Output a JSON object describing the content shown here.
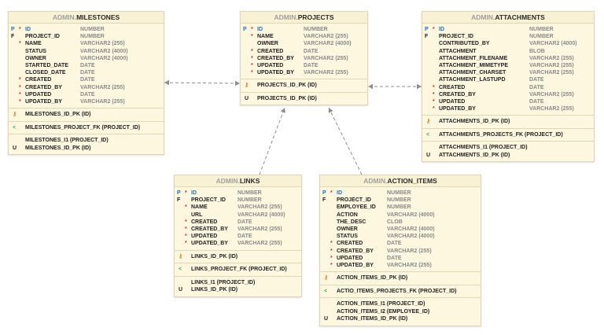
{
  "tables": [
    {
      "id": "milestones",
      "schema": "ADMIN.",
      "name": "MILESTONES",
      "columns": [
        {
          "key": "P",
          "req": "*",
          "name": "ID",
          "type": "NUMBER"
        },
        {
          "key": "F",
          "req": "",
          "name": "PROJECT_ID",
          "type": "NUMBER"
        },
        {
          "key": "",
          "req": "*",
          "name": "NAME",
          "type": "VARCHAR2 (255)"
        },
        {
          "key": "",
          "req": "",
          "name": "STATUS",
          "type": "VARCHAR2 (4000)"
        },
        {
          "key": "",
          "req": "",
          "name": "OWNER",
          "type": "VARCHAR2 (4000)"
        },
        {
          "key": "",
          "req": "",
          "name": "STARTED_DATE",
          "type": "DATE"
        },
        {
          "key": "",
          "req": "",
          "name": "CLOSED_DATE",
          "type": "DATE"
        },
        {
          "key": "",
          "req": "*",
          "name": "CREATED",
          "type": "DATE"
        },
        {
          "key": "",
          "req": "*",
          "name": "CREATED_BY",
          "type": "VARCHAR2 (255)"
        },
        {
          "key": "",
          "req": "*",
          "name": "UPDATED",
          "type": "DATE"
        },
        {
          "key": "",
          "req": "*",
          "name": "UPDATED_BY",
          "type": "VARCHAR2 (255)"
        }
      ],
      "pk": [
        "MILESTONES_ID_PK (ID)"
      ],
      "fk": [
        "MILESTONES_PROJECT_FK (PROJECT_ID)"
      ],
      "indexes": [
        {
          "u": "",
          "label": "MILESTONES_I1 (PROJECT_ID)"
        },
        {
          "u": "U",
          "label": "MILESTONES_ID_PK (ID)"
        }
      ]
    },
    {
      "id": "projects",
      "schema": "ADMIN.",
      "name": "PROJECTS",
      "columns": [
        {
          "key": "P",
          "req": "*",
          "name": "ID",
          "type": "NUMBER"
        },
        {
          "key": "",
          "req": "*",
          "name": "NAME",
          "type": "VARCHAR2 (255)"
        },
        {
          "key": "",
          "req": "",
          "name": "OWNER",
          "type": "VARCHAR2 (4000)"
        },
        {
          "key": "",
          "req": "*",
          "name": "CREATED",
          "type": "DATE"
        },
        {
          "key": "",
          "req": "*",
          "name": "CREATED_BY",
          "type": "VARCHAR2 (255)"
        },
        {
          "key": "",
          "req": "*",
          "name": "UPDATED",
          "type": "DATE"
        },
        {
          "key": "",
          "req": "*",
          "name": "UPDATED_BY",
          "type": "VARCHAR2 (255)"
        }
      ],
      "pk": [
        "PROJECTS_ID_PK (ID)"
      ],
      "fk": [],
      "indexes": [
        {
          "u": "U",
          "label": "PROJECTS_ID_PK (ID)"
        }
      ]
    },
    {
      "id": "attachments",
      "schema": "ADMIN.",
      "name": "ATTACHMENTS",
      "columns": [
        {
          "key": "P",
          "req": "*",
          "name": "ID",
          "type": "NUMBER"
        },
        {
          "key": "F",
          "req": "",
          "name": "PROJECT_ID",
          "type": "NUMBER"
        },
        {
          "key": "",
          "req": "",
          "name": "CONTRIBUTED_BY",
          "type": "VARCHAR2 (4000)"
        },
        {
          "key": "",
          "req": "",
          "name": "ATTACHMENT",
          "type": "BLOB"
        },
        {
          "key": "",
          "req": "",
          "name": "ATTACHMENT_FILENAME",
          "type": "VARCHAR2 (255)"
        },
        {
          "key": "",
          "req": "",
          "name": "ATTACHMENT_MIMETYPE",
          "type": "VARCHAR2 (255)"
        },
        {
          "key": "",
          "req": "",
          "name": "ATTACHMENT_CHARSET",
          "type": "VARCHAR2 (255)"
        },
        {
          "key": "",
          "req": "",
          "name": "ATTACHMENT_LASTUPD",
          "type": "DATE"
        },
        {
          "key": "",
          "req": "*",
          "name": "CREATED",
          "type": "DATE"
        },
        {
          "key": "",
          "req": "*",
          "name": "CREATED_BY",
          "type": "VARCHAR2 (255)"
        },
        {
          "key": "",
          "req": "*",
          "name": "UPDATED",
          "type": "DATE"
        },
        {
          "key": "",
          "req": "*",
          "name": "UPDATED_BY",
          "type": "VARCHAR2 (255)"
        }
      ],
      "pk": [
        "ATTACHMENTS_ID_PK (ID)"
      ],
      "fk": [
        "ATTACHMENTS_PROJECTS_FK (PROJECT_ID)"
      ],
      "indexes": [
        {
          "u": "",
          "label": "ATTACHMENTS_I1 (PROJECT_ID)"
        },
        {
          "u": "U",
          "label": "ATTACHMENTS_ID_PK (ID)"
        }
      ]
    },
    {
      "id": "links",
      "schema": "ADMIN.",
      "name": "LINKS",
      "columns": [
        {
          "key": "P",
          "req": "*",
          "name": "ID",
          "type": "NUMBER"
        },
        {
          "key": "F",
          "req": "",
          "name": "PROJECT_ID",
          "type": "NUMBER"
        },
        {
          "key": "",
          "req": "*",
          "name": "NAME",
          "type": "VARCHAR2 (255)"
        },
        {
          "key": "",
          "req": "",
          "name": "URL",
          "type": "VARCHAR2 (4000)"
        },
        {
          "key": "",
          "req": "*",
          "name": "CREATED",
          "type": "DATE"
        },
        {
          "key": "",
          "req": "*",
          "name": "CREATED_BY",
          "type": "VARCHAR2 (255)"
        },
        {
          "key": "",
          "req": "*",
          "name": "UPDATED",
          "type": "DATE"
        },
        {
          "key": "",
          "req": "*",
          "name": "UPDATED_BY",
          "type": "VARCHAR2 (255)"
        }
      ],
      "pk": [
        "LINKS_ID_PK (ID)"
      ],
      "fk": [
        "LINKS_PROJECT_FK (PROJECT_ID)"
      ],
      "indexes": [
        {
          "u": "",
          "label": "LINKS_I1 (PROJECT_ID)"
        },
        {
          "u": "U",
          "label": "LINKS_ID_PK (ID)"
        }
      ]
    },
    {
      "id": "action_items",
      "schema": "ADMIN.",
      "name": "ACTION_ITEMS",
      "columns": [
        {
          "key": "P",
          "req": "*",
          "name": "ID",
          "type": "NUMBER"
        },
        {
          "key": "F",
          "req": "",
          "name": "PROJECT_ID",
          "type": "NUMBER"
        },
        {
          "key": "",
          "req": "",
          "name": "EMPLOYEE_ID",
          "type": "NUMBER"
        },
        {
          "key": "",
          "req": "",
          "name": "ACTION",
          "type": "VARCHAR2 (4000)"
        },
        {
          "key": "",
          "req": "",
          "name": "THE_DESC",
          "type": "CLOB"
        },
        {
          "key": "",
          "req": "",
          "name": "OWNER",
          "type": "VARCHAR2 (4000)"
        },
        {
          "key": "",
          "req": "",
          "name": "STATUS",
          "type": "VARCHAR2 (4000)"
        },
        {
          "key": "",
          "req": "*",
          "name": "CREATED",
          "type": "DATE"
        },
        {
          "key": "",
          "req": "*",
          "name": "CREATED_BY",
          "type": "VARCHAR2 (255)"
        },
        {
          "key": "",
          "req": "*",
          "name": "UPDATED",
          "type": "DATE"
        },
        {
          "key": "",
          "req": "*",
          "name": "UPDATED_BY",
          "type": "VARCHAR2 (255)"
        }
      ],
      "pk": [
        "ACTION_ITEMS_ID_PK (ID)"
      ],
      "fk": [
        "ACTIO_ITEMS_PROJECTS_FK (PROJECT_ID)"
      ],
      "indexes": [
        {
          "u": "",
          "label": "ACTION_ITEMS_I1 (PROJECT_ID)"
        },
        {
          "u": "",
          "label": "ACTION_ITEMS_I2 (EMPLOYEE_ID)"
        },
        {
          "u": "U",
          "label": "ACTION_ITEMS_ID_PK (ID)"
        }
      ]
    }
  ],
  "relations": [
    {
      "from": "milestones",
      "to": "projects"
    },
    {
      "from": "attachments",
      "to": "projects"
    },
    {
      "from": "links",
      "to": "projects"
    },
    {
      "from": "action_items",
      "to": "projects"
    }
  ],
  "colors": {
    "table_bg": "#fdf7e0",
    "pk_blue": "#1f6fb5",
    "required_red": "#c0392b",
    "type_gray": "#8a8a8a",
    "line": "#8c8c8c"
  }
}
